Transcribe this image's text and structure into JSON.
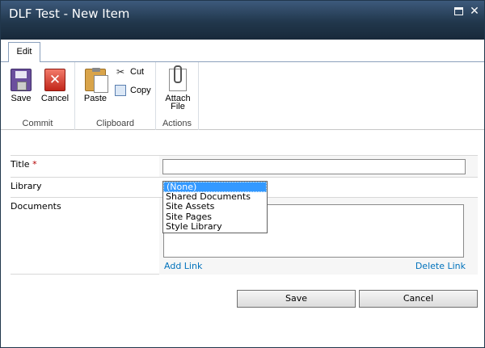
{
  "window": {
    "title": "DLF Test - New Item"
  },
  "ribbon": {
    "tabs": [
      {
        "label": "Edit"
      }
    ],
    "groups": {
      "commit": {
        "label": "Commit",
        "save": "Save",
        "cancel": "Cancel"
      },
      "clipboard": {
        "label": "Clipboard",
        "paste": "Paste",
        "cut": "Cut",
        "copy": "Copy"
      },
      "actions": {
        "label": "Actions",
        "attach_line1": "Attach",
        "attach_line2": "File"
      }
    }
  },
  "form": {
    "title_label": "Title",
    "required_marker": "*",
    "title_value": "",
    "library_label": "Library",
    "library_options": [
      "(None)",
      "Shared Documents",
      "Site Assets",
      "Site Pages",
      "Style Library"
    ],
    "library_selected": "(None)",
    "documents_label": "Documents",
    "add_link": "Add Link",
    "delete_link": "Delete Link"
  },
  "footer": {
    "save": "Save",
    "cancel": "Cancel"
  },
  "icons": {
    "save": "floppy-disk-icon",
    "cancel": "red-x-icon",
    "paste": "clipboard-icon",
    "cut": "scissors-icon",
    "copy": "copy-icon",
    "attach": "paperclip-document-icon",
    "maximize": "maximize-icon",
    "close": "close-icon"
  },
  "colors": {
    "titlebar": "#21374c",
    "link": "#0072bc",
    "selection": "#3399ff",
    "required": "#b40000"
  }
}
